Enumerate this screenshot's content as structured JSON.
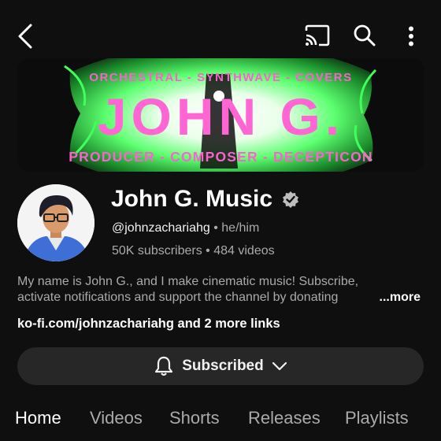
{
  "banner": {
    "top_text": "ORCHESTRAL - SYNTHWAVE - COVERS",
    "main_text": "JOHN G.",
    "bottom_text": "PRODUCER - COMPOSER - DECEPTICON"
  },
  "channel": {
    "name": "John G. Music",
    "handle": "@johnzachariahg",
    "separator": "•",
    "pronouns": "he/him",
    "subscribers": "50K subscribers",
    "videos": "484 videos"
  },
  "description": {
    "line1": "My name is John G., and I make cinematic music! Subscribe,",
    "line2": "activate notifications and support the channel by donating",
    "more": "...more"
  },
  "links": {
    "text": "ko-fi.com/johnzachariahg and 2 more links"
  },
  "subscribe": {
    "label": "Subscribed"
  },
  "tabs": [
    "Home",
    "Videos",
    "Shorts",
    "Releases",
    "Playlists"
  ],
  "icons": {
    "back": "back-arrow-icon",
    "cast": "cast-icon",
    "search": "search-icon",
    "more": "more-vertical-icon",
    "verified": "verified-badge-icon",
    "bell": "bell-icon",
    "chevron": "chevron-down-icon"
  },
  "colors": {
    "background": "#0f0f0f",
    "banner_pink": "#ff66d4",
    "banner_green": "#41ff5a",
    "button_bg": "#272727",
    "muted_text": "#aaaaaa"
  }
}
